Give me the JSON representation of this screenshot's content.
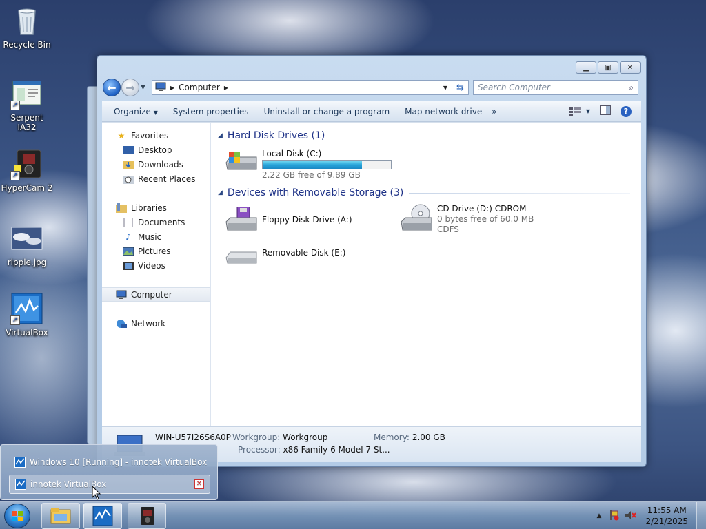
{
  "desktop": {
    "icons": [
      {
        "label": "Recycle Bin"
      },
      {
        "label": "Serpent IA32"
      },
      {
        "label": "HyperCam 2"
      },
      {
        "label": "ripple.jpg"
      },
      {
        "label": "VirtualBox"
      }
    ]
  },
  "window": {
    "breadcrumb": "Computer",
    "search_placeholder": "Search Computer",
    "toolbar": {
      "organize": "Organize",
      "system_properties": "System properties",
      "uninstall": "Uninstall or change a program",
      "map_drive": "Map network drive",
      "more": "»"
    },
    "nav": {
      "favorites": "Favorites",
      "desktop": "Desktop",
      "downloads": "Downloads",
      "recent_places": "Recent Places",
      "libraries": "Libraries",
      "documents": "Documents",
      "music": "Music",
      "pictures": "Pictures",
      "videos": "Videos",
      "computer": "Computer",
      "network": "Network"
    },
    "groups": {
      "hdd": "Hard Disk Drives (1)",
      "removable": "Devices with Removable Storage (3)"
    },
    "drives": {
      "local_disk": {
        "name": "Local Disk (C:)",
        "info": "2.22 GB free of 9.89 GB",
        "used_fraction": 0.775
      },
      "floppy": {
        "name": "Floppy Disk Drive (A:)"
      },
      "cdrom": {
        "name": "CD Drive (D:) CDROM",
        "info": "0 bytes free of 60.0 MB",
        "fs": "CDFS"
      },
      "removable": {
        "name": "Removable Disk (E:)"
      }
    },
    "details": {
      "computer_name": "WIN-U57I26S6A0P",
      "workgroup_label": "Workgroup:",
      "workgroup_value": "Workgroup",
      "memory_label": "Memory:",
      "memory_value": "2.00 GB",
      "processor_label": "Processor:",
      "processor_value": "x86 Family 6 Model 7 St..."
    }
  },
  "popup": {
    "items": [
      {
        "label": "Windows 10 [Running] - innotek VirtualBox"
      },
      {
        "label": "innotek VirtualBox"
      }
    ]
  },
  "taskbar": {
    "clock_time": "11:55 AM",
    "clock_date": "2/21/2025"
  }
}
